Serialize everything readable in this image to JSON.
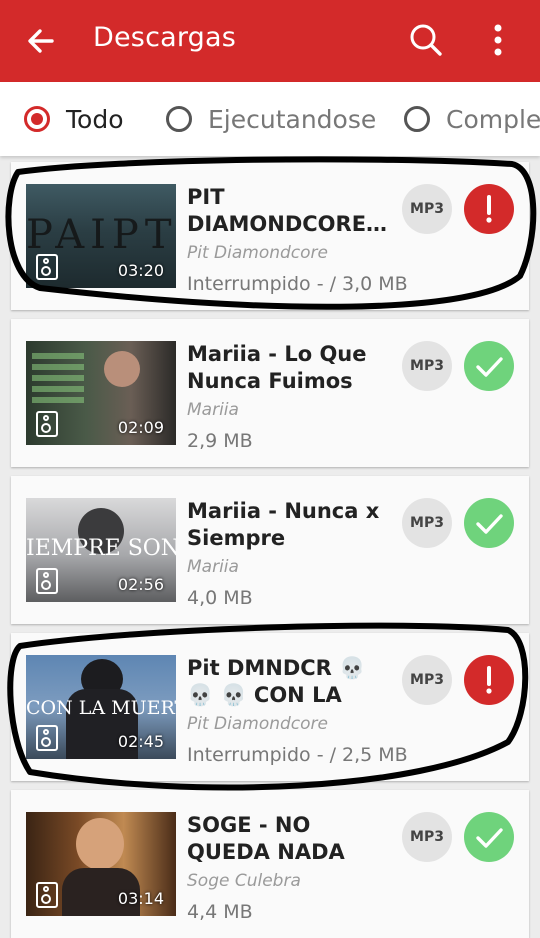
{
  "appbar": {
    "title": "Descargas",
    "back_icon": "arrow-back-icon",
    "search_icon": "search-icon",
    "more_icon": "more-vert-icon"
  },
  "tabs": [
    {
      "label": "Todo",
      "selected": true
    },
    {
      "label": "Ejecutandose",
      "selected": false
    },
    {
      "label": "Completado",
      "selected": false
    }
  ],
  "colors": {
    "primary": "#d32a2a",
    "success": "#6fd37c",
    "error": "#d32a2a"
  },
  "downloads": [
    {
      "title": "PIT DIAMONDCORE…",
      "artist": "Pit Diamondcore",
      "duration": "03:20",
      "status": "Interrumpido  - / 3,0 MB",
      "format": "MP3",
      "state": "error",
      "state_symbol": "!"
    },
    {
      "title": "Mariia - Lo Que Nunca Fuimos (co…",
      "artist": "Mariia",
      "duration": "02:09",
      "status": "2,9 MB",
      "format": "MP3",
      "state": "done",
      "state_symbol": "✓"
    },
    {
      "title": "Mariia - Nunca x Siempre (Videocli…",
      "artist": "Mariia",
      "duration": "02:56",
      "status": "4,0 MB",
      "format": "MP3",
      "state": "done",
      "state_symbol": "✓"
    },
    {
      "title": "Pit DMNDCR 💀 💀 💀 CON LA",
      "artist": "Pit Diamondcore",
      "duration": "02:45",
      "status": "Interrumpido  - / 2,5 MB",
      "format": "MP3",
      "state": "error",
      "state_symbol": "!"
    },
    {
      "title": "SOGE - NO QUEDA NADA [MENTE…",
      "artist": "Soge Culebra",
      "duration": "03:14",
      "status": "4,4 MB",
      "format": "MP3",
      "state": "done",
      "state_symbol": "✓"
    }
  ]
}
